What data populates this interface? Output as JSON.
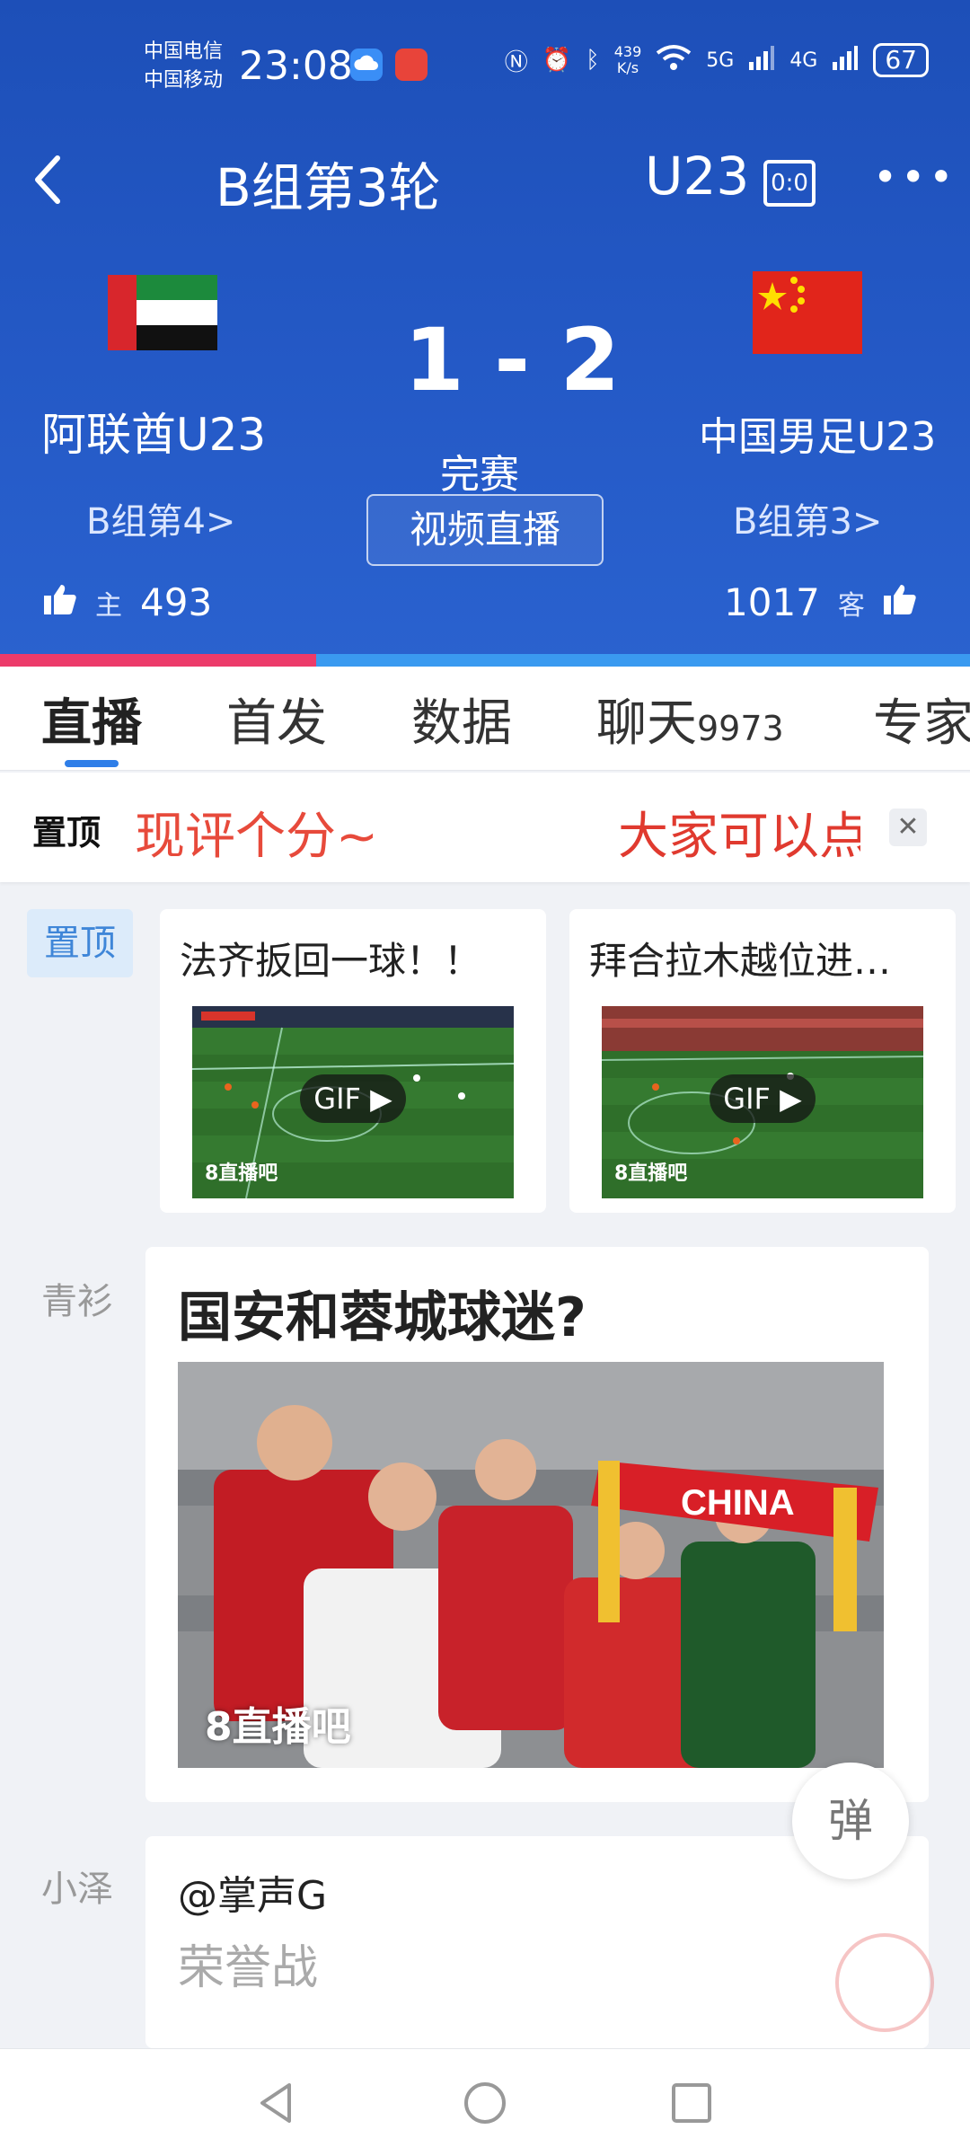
{
  "status_bar": {
    "carrier_1": "中国电信",
    "carrier_2": "中国移动",
    "time": "23:08",
    "net_speed_value": "439",
    "net_speed_unit": "K/s",
    "signal_1": "5G",
    "signal_2": "4G",
    "battery": "67"
  },
  "header": {
    "title": "B组第3轮",
    "category": "U23",
    "scoreboard_icon": "0:0"
  },
  "match": {
    "home": {
      "name": "阿联酋U23",
      "rank": "B组第4>",
      "role": "主",
      "likes": "493",
      "flag": "uae-flag"
    },
    "away": {
      "name": "中国男足U23",
      "rank": "B组第3>",
      "role": "客",
      "likes": "1017",
      "flag": "china-flag"
    },
    "score": "1 - 2",
    "status": "完赛",
    "video_button": "视频直播",
    "home_vote_fraction": 0.326
  },
  "tabs": [
    {
      "label": "直播",
      "active": true
    },
    {
      "label": "首发"
    },
    {
      "label": "数据"
    },
    {
      "label": "聊天",
      "count": "9973"
    },
    {
      "label": "专家"
    }
  ],
  "pinned_bar": {
    "logo": "置顶",
    "text_a": "现评个分~",
    "text_b": "大家可以点",
    "close": "✕"
  },
  "feed": {
    "pin_tag": "置顶",
    "gif_cards": [
      {
        "title": "法齐扳回一球！！",
        "badge": "GIF ▶",
        "watermark": "8直播吧"
      },
      {
        "title": "拜合拉木越位进…",
        "badge": "GIF ▶",
        "watermark": "8直播吧"
      }
    ],
    "messages": [
      {
        "user": "青衫",
        "title": "国安和蓉城球迷?",
        "photo_text": "CHINA",
        "watermark": "8直播吧"
      },
      {
        "user": "小泽",
        "mention": "@掌声G",
        "text": "荣誉战"
      }
    ],
    "danmu_button": "弹"
  },
  "colors": {
    "header_blue": "#2459c6",
    "home_bar": "#ec3b6a",
    "away_bar": "#3a9af0",
    "accent_red": "#e74a3b",
    "tab_underline": "#2f7ee8"
  }
}
